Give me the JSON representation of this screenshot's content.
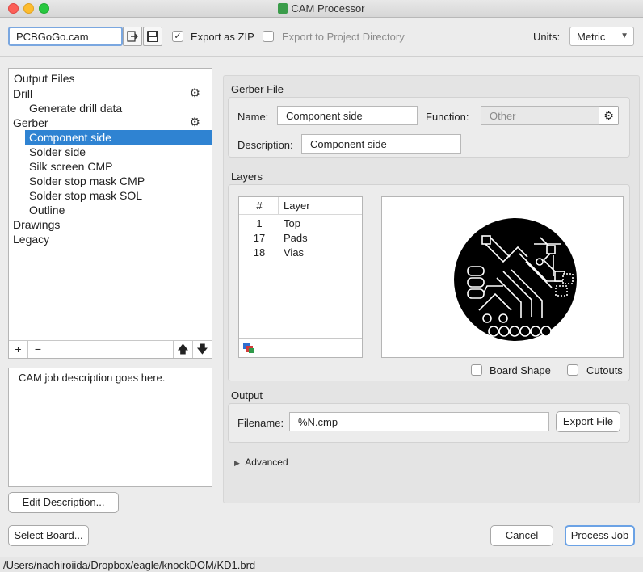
{
  "window": {
    "title": "CAM Processor"
  },
  "toolbar": {
    "cam_file": "PCBGoGo.cam",
    "export_zip": {
      "label": "Export as ZIP",
      "checked": true
    },
    "export_project": {
      "label": "Export to Project Directory",
      "checked": false
    },
    "units_label": "Units:",
    "units_value": "Metric"
  },
  "output_files": {
    "header": "Output Files",
    "items": [
      {
        "label": "Drill",
        "level": 0,
        "gear": true
      },
      {
        "label": "Generate drill data",
        "level": 1
      },
      {
        "label": "Gerber",
        "level": 0,
        "gear": true
      },
      {
        "label": "Component side",
        "level": 1,
        "selected": true
      },
      {
        "label": "Solder side",
        "level": 1
      },
      {
        "label": "Silk screen CMP",
        "level": 1
      },
      {
        "label": "Solder stop mask CMP",
        "level": 1
      },
      {
        "label": "Solder stop mask SOL",
        "level": 1
      },
      {
        "label": "Outline",
        "level": 1
      },
      {
        "label": "Drawings",
        "level": 0
      },
      {
        "label": "Legacy",
        "level": 0
      }
    ],
    "tools": {
      "add": "+",
      "remove": "−",
      "up": "🡅",
      "down": "🡇"
    }
  },
  "description": {
    "text": "CAM job description goes here.",
    "edit_button": "Edit Description..."
  },
  "select_board_button": "Select Board...",
  "gerber_file": {
    "section_title": "Gerber File",
    "name_label": "Name:",
    "name_value": "Component side",
    "function_label": "Function:",
    "function_value": "Other",
    "description_label": "Description:",
    "description_value": "Component side"
  },
  "layers": {
    "section_title": "Layers",
    "col_num": "#",
    "col_layer": "Layer",
    "rows": [
      {
        "num": "1",
        "name": "Top"
      },
      {
        "num": "17",
        "name": "Pads"
      },
      {
        "num": "18",
        "name": "Vias"
      }
    ],
    "board_shape": {
      "label": "Board Shape",
      "checked": false
    },
    "cutouts": {
      "label": "Cutouts",
      "checked": false
    }
  },
  "output": {
    "section_title": "Output",
    "filename_label": "Filename:",
    "filename_value": "%N.cmp",
    "export_button": "Export File"
  },
  "advanced": {
    "label": "Advanced"
  },
  "footer": {
    "cancel": "Cancel",
    "process": "Process Job"
  },
  "status": {
    "path": "/Users/naohiroiida/Dropbox/eagle/knockDOM/KD1.brd"
  },
  "colors": {
    "selection": "#2f83d2",
    "focus": "#6ba2e5"
  }
}
